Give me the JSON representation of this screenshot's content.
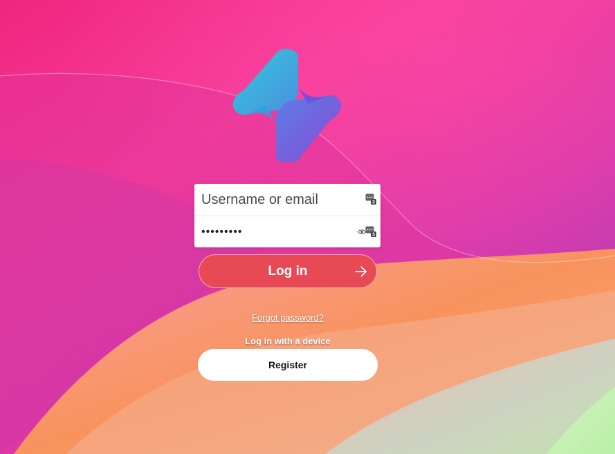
{
  "app": {
    "logo_icon": "hexagonal-h-logo-icon"
  },
  "login": {
    "username_placeholder": "Username or email",
    "username_value": "",
    "password_value": "passwordx",
    "password_manager_icon": "password-manager-icon",
    "password_manager_badge": "3",
    "reveal_icon": "eye-icon",
    "submit_label": "Log in",
    "submit_icon": "arrow-right-icon"
  },
  "links": {
    "forgot_password": "Forgot password?",
    "login_device": "Log in with a device"
  },
  "register": {
    "label": "Register"
  },
  "colors": {
    "background_pink": "#f2389a",
    "background_orange": "#f8955a",
    "login_button": "#e84a55",
    "logo_cyan": "#38c2d8",
    "logo_purple": "#7b54d9"
  }
}
